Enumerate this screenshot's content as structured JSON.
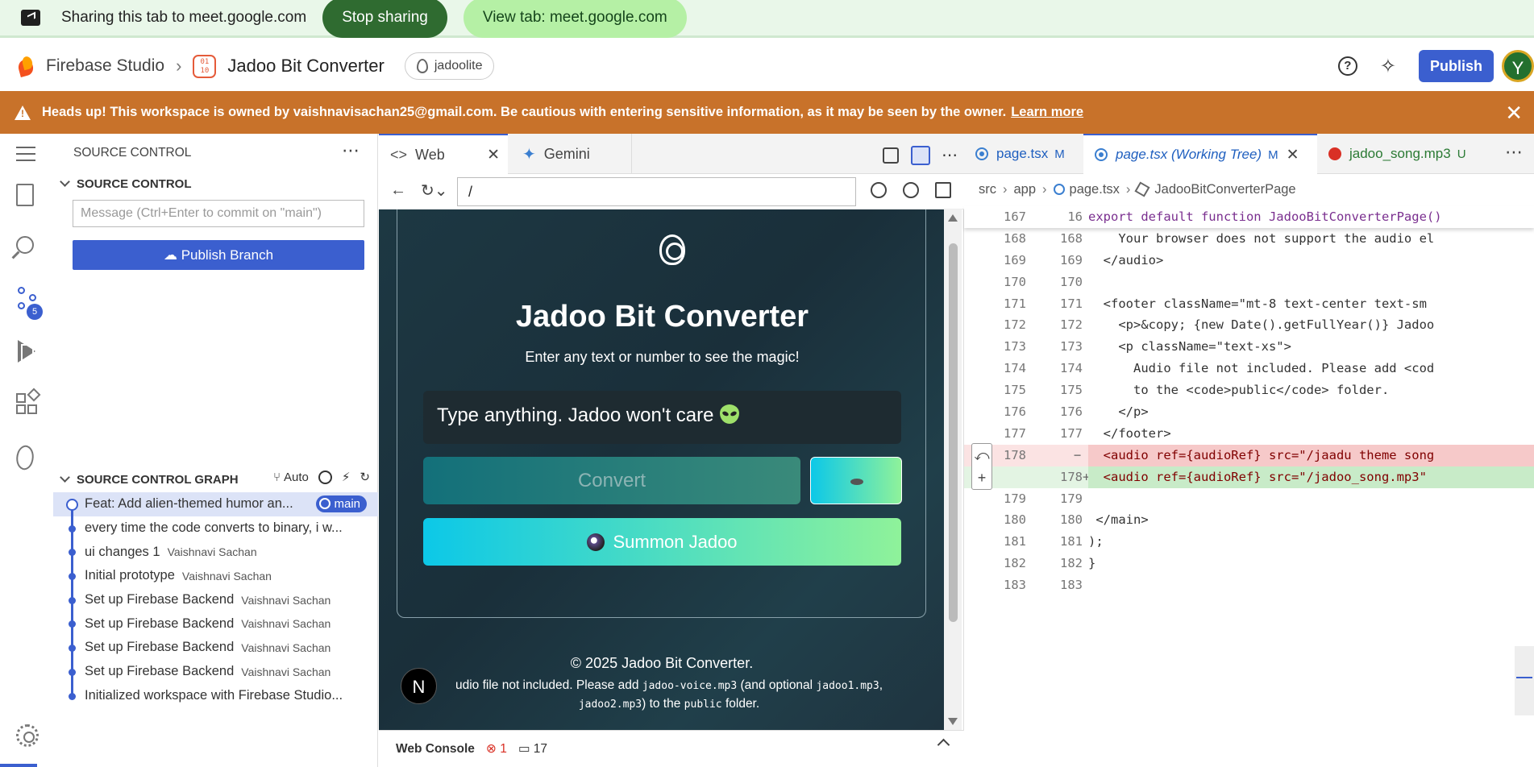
{
  "share_bar": {
    "text": "Sharing this tab to meet.google.com",
    "stop_label": "Stop sharing",
    "view_label": "View tab: meet.google.com"
  },
  "topbar": {
    "brand": "Firebase Studio",
    "app_icon_text": "01 10",
    "app_name": "Jadoo Bit Converter",
    "org": "jadoolite",
    "publish": "Publish",
    "avatar": "Y",
    "help": "?"
  },
  "warning": {
    "text": "Heads up! This workspace is owned by vaishnavisachan25@gmail.com. Be cautious with entering sensitive information, as it may be seen by the owner.",
    "link": "Learn more",
    "close": "✕"
  },
  "activity": {
    "scm_badge": "5"
  },
  "scm": {
    "title": "SOURCE CONTROL",
    "section": "SOURCE CONTROL",
    "message_placeholder": "Message (Ctrl+Enter to commit on \"main\")",
    "publish_branch": "Publish Branch",
    "graph_title": "SOURCE CONTROL GRAPH",
    "graph_auto": "Auto",
    "commits": [
      {
        "msg": "Feat: Add alien-themed humor an...",
        "author": "",
        "tag": "main"
      },
      {
        "msg": "every time the code converts to binary, i w...",
        "author": ""
      },
      {
        "msg": "ui changes 1",
        "author": "Vaishnavi Sachan"
      },
      {
        "msg": "Initial prototype",
        "author": "Vaishnavi Sachan"
      },
      {
        "msg": "Set up Firebase Backend",
        "author": "Vaishnavi Sachan"
      },
      {
        "msg": "Set up Firebase Backend",
        "author": "Vaishnavi Sachan"
      },
      {
        "msg": "Set up Firebase Backend",
        "author": "Vaishnavi Sachan"
      },
      {
        "msg": "Set up Firebase Backend",
        "author": "Vaishnavi Sachan"
      },
      {
        "msg": "Initialized workspace with Firebase Studio...",
        "author": ""
      }
    ]
  },
  "web": {
    "tab_web": "Web",
    "tab_gemini": "Gemini",
    "url": "/",
    "app": {
      "title": "Jadoo Bit Converter",
      "subtitle": "Enter any text or number to see the magic!",
      "input_placeholder": "Type anything. Jadoo won't care",
      "convert": "Convert",
      "summon": "Summon Jadoo",
      "footer_copy": "© 2025 Jadoo Bit Converter.",
      "footer_note_1": "udio file not included. Please add ",
      "footer_code_1": "jadoo-voice.mp3",
      "footer_note_2": " (and optional ",
      "footer_code_2": "jadoo1.mp3",
      "footer_note_3": ",",
      "footer_code_3": "jadoo2.mp3",
      "footer_note_4": ") to the ",
      "footer_code_4": "public",
      "footer_note_5": " folder.",
      "next_badge": "N"
    },
    "console_label": "Web Console",
    "console_errors": "1",
    "console_messages": "17"
  },
  "editor": {
    "tabs": [
      {
        "name": "page.tsx",
        "status": "M"
      },
      {
        "name": "page.tsx (Working Tree)",
        "status": "M"
      },
      {
        "name": "jadoo_song.mp3",
        "status": "U"
      }
    ],
    "breadcrumb": [
      "src",
      "app",
      "page.tsx",
      "JadooBitConverterPage"
    ],
    "lines": [
      {
        "a": "167",
        "b": "16",
        "code": "export default function JadooBitConverterPage() "
      },
      {
        "a": "168",
        "b": "168",
        "code": "    Your browser does not support the audio el"
      },
      {
        "a": "169",
        "b": "169",
        "code": "  </audio>"
      },
      {
        "a": "170",
        "b": "170",
        "code": ""
      },
      {
        "a": "171",
        "b": "171",
        "code": "  <footer className=\"mt-8 text-center text-sm "
      },
      {
        "a": "172",
        "b": "172",
        "code": "    <p>&copy; {new Date().getFullYear()} Jadoo"
      },
      {
        "a": "173",
        "b": "173",
        "code": "    <p className=\"text-xs\">"
      },
      {
        "a": "174",
        "b": "174",
        "code": "      Audio file not included. Please add <cod"
      },
      {
        "a": "175",
        "b": "175",
        "code": "      to the <code>public</code> folder."
      },
      {
        "a": "176",
        "b": "176",
        "code": "    </p>"
      },
      {
        "a": "177",
        "b": "177",
        "code": "  </footer>"
      },
      {
        "a": "178",
        "b": "",
        "code": "  <audio ref={audioRef} src=\"/jaadu theme song",
        "kind": "del",
        "mark": "−"
      },
      {
        "a": "",
        "b": "178",
        "code": "  <audio ref={audioRef} src=\"/jadoo_song.mp3\"",
        "kind": "add",
        "mark": "+"
      },
      {
        "a": "179",
        "b": "179",
        "code": ""
      },
      {
        "a": "180",
        "b": "180",
        "code": " </main>"
      },
      {
        "a": "181",
        "b": "181",
        "code": ");"
      },
      {
        "a": "182",
        "b": "182",
        "code": "}"
      },
      {
        "a": "183",
        "b": "183",
        "code": ""
      }
    ]
  }
}
